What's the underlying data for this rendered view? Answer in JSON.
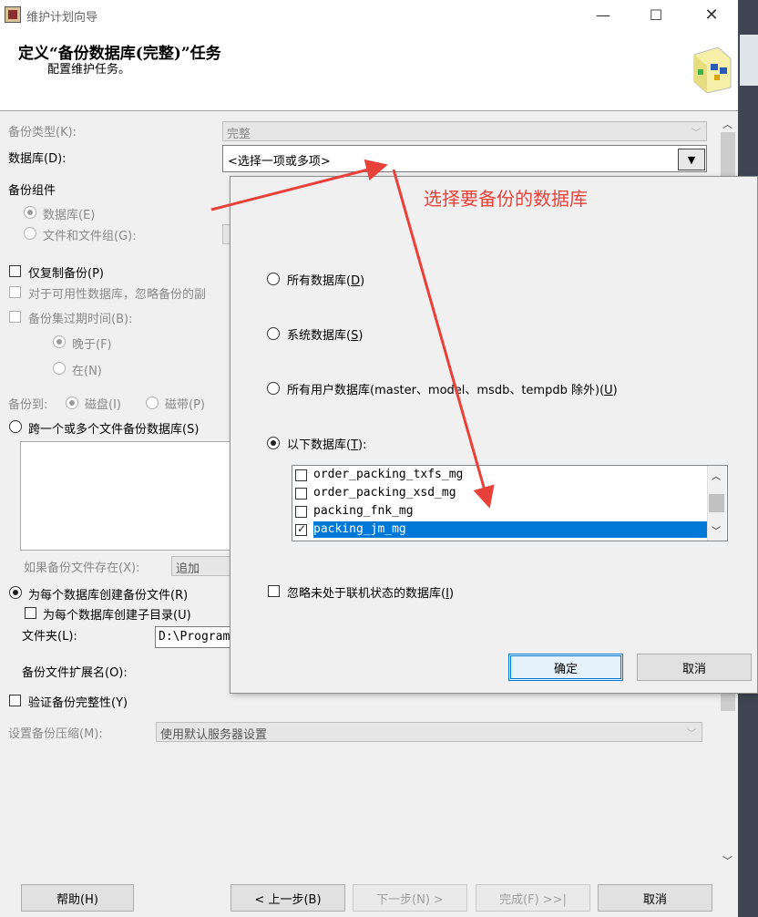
{
  "window": {
    "title": "维护计划向导"
  },
  "header": {
    "title": "定义“备份数据库(完整)”任务",
    "subtitle": "配置维护任务。"
  },
  "form": {
    "backup_type_label": "备份类型(K):",
    "backup_type_value": "完整",
    "database_label": "数据库(D):",
    "database_value": "<选择一项或多项>",
    "backup_component_label": "备份组件",
    "component_database": "数据库(E)",
    "component_files": "文件和文件组(G):",
    "copy_only": "仅复制备份(P)",
    "ag_note": "对于可用性数据库，忽略备份的副",
    "expire_label": "备份集过期时间(B):",
    "expire_after": "晚于(F)",
    "expire_on": "在(N)",
    "backup_to_label": "备份到:",
    "backup_to_disk": "磁盘(I)",
    "backup_to_tape": "磁带(P)",
    "span_files": "跨一个或多个文件备份数据库(S)",
    "if_exists_label": "如果备份文件存在(X):",
    "if_exists_value": "追加",
    "per_db_file": "为每个数据库创建备份文件(R)",
    "per_db_subdir": "为每个数据库创建子目录(U)",
    "folder_label": "文件夹(L):",
    "folder_value": "D:\\Program",
    "ext_label": "备份文件扩展名(O):",
    "verify": "验证备份完整性(Y)",
    "compression_label": "设置备份压缩(M):",
    "compression_value": "使用默认服务器设置"
  },
  "footer": {
    "help": "帮助(H)",
    "prev": "< 上一步(B)",
    "next": "下一步(N) >",
    "finish": "完成(F) >>|",
    "cancel": "取消"
  },
  "annotation": {
    "text": "选择要备份的数据库",
    "color": "#e8413a"
  },
  "dialog": {
    "opt_all": "所有数据库",
    "opt_all_key": "D",
    "opt_system": "系统数据库",
    "opt_system_key": "S",
    "opt_user": "所有用户数据库(master、model、msdb、tempdb 除外)",
    "opt_user_key": "U",
    "opt_these": "以下数据库",
    "opt_these_key": "T",
    "list_items": [
      {
        "name": "order_packing_txfs_mg",
        "checked": false
      },
      {
        "name": "order_packing_xsd_mg",
        "checked": false
      },
      {
        "name": "packing_fnk_mg",
        "checked": false
      },
      {
        "name": "packing_jm_mg",
        "checked": true
      }
    ],
    "ignore_offline": "忽略未处于联机状态的数据库",
    "ignore_offline_key": "I",
    "ok": "确定",
    "cancel": "取消"
  }
}
